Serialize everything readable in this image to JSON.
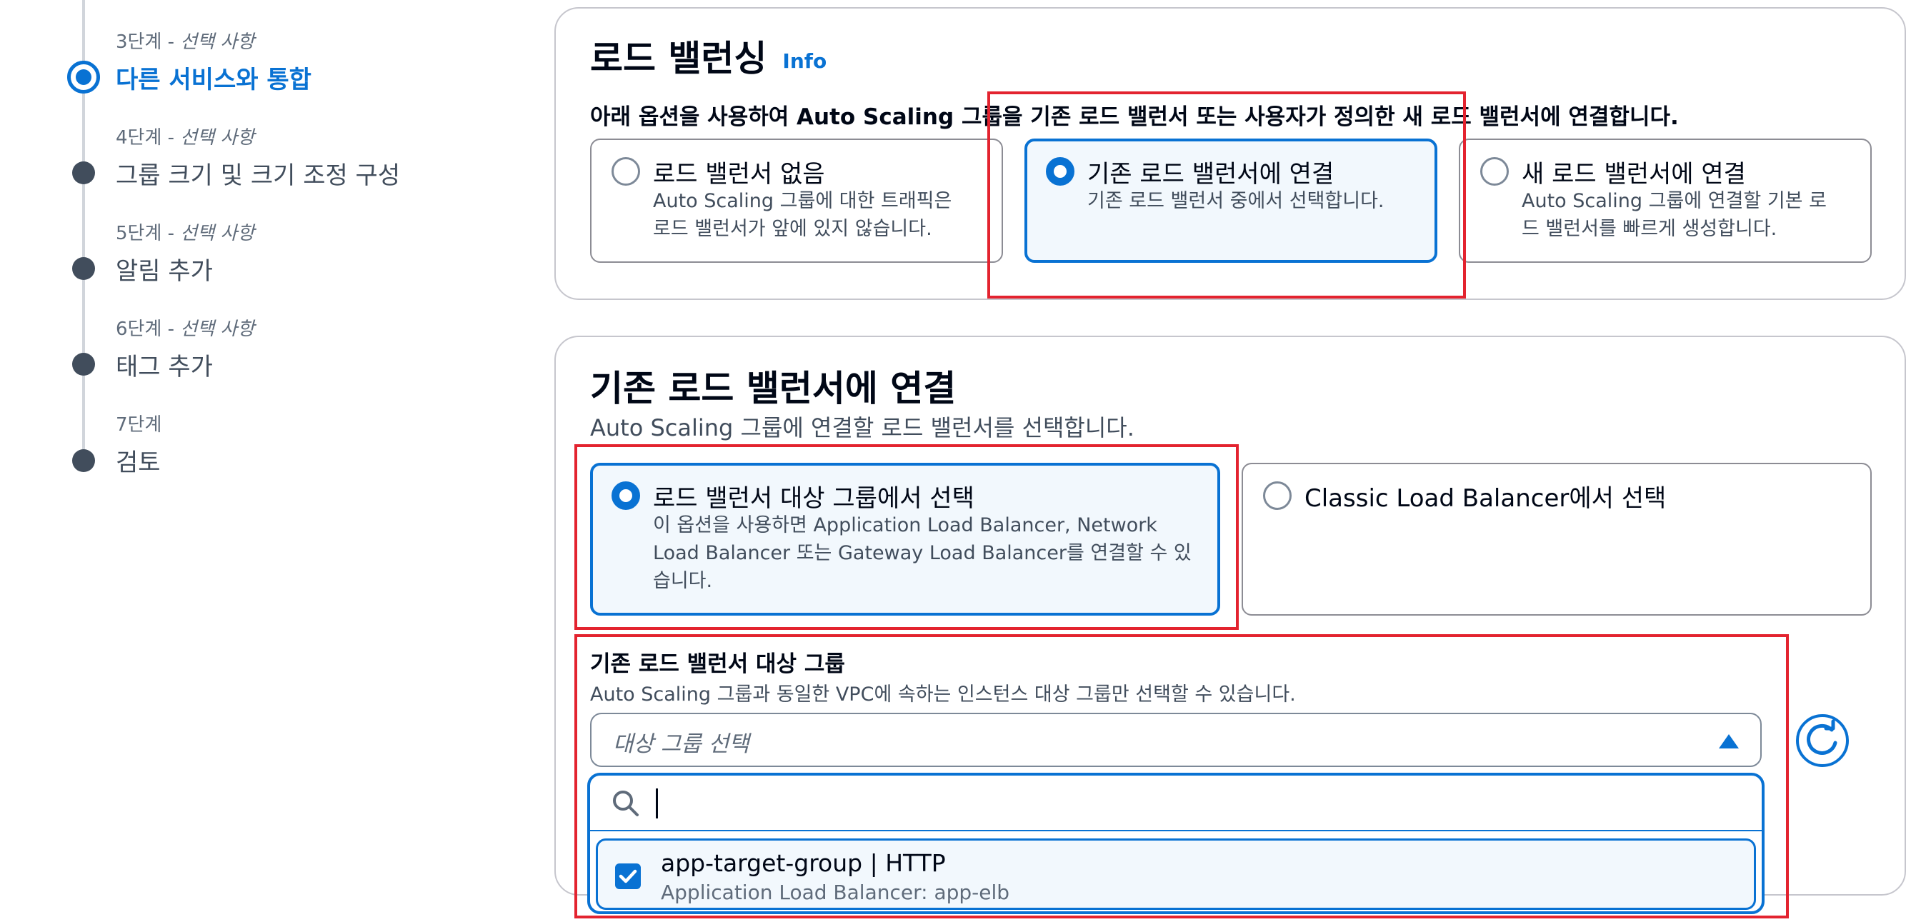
{
  "steps": [
    {
      "label_prefix": "3단계 - ",
      "label_suffix": "선택 사항",
      "title": "다른 서비스와 통합",
      "active": true
    },
    {
      "label_prefix": "4단계 - ",
      "label_suffix": "선택 사항",
      "title": "그룹 크기 및 크기 조정 구성"
    },
    {
      "label_prefix": "5단계 - ",
      "label_suffix": "선택 사항",
      "title": "알림 추가"
    },
    {
      "label_prefix": "6단계 - ",
      "label_suffix": "선택 사항",
      "title": "태그 추가"
    },
    {
      "label_prefix": "7단계",
      "label_suffix": "",
      "title": "검토"
    }
  ],
  "load_balancing": {
    "title": "로드 밸런싱",
    "info": "Info",
    "description": "아래 옵션을 사용하여 Auto Scaling 그룹을 기존 로드 밸런서 또는 사용자가 정의한 새 로드 밸런서에 연결합니다.",
    "options": [
      {
        "title": "로드 밸런서 없음",
        "desc1": "Auto Scaling 그룹에 대한 트래픽은",
        "desc2": "로드 밸런서가 앞에 있지 않습니다."
      },
      {
        "title": "기존 로드 밸런서에 연결",
        "desc1": "기존 로드 밸런서 중에서 선택합니다.",
        "desc2": ""
      },
      {
        "title": "새 로드 밸런서에 연결",
        "desc1": "Auto Scaling 그룹에 연결할 기본 로",
        "desc2": "드 밸런서를 빠르게 생성합니다."
      }
    ],
    "selected_index": 1
  },
  "attach_existing": {
    "title": "기존 로드 밸런서에 연결",
    "description": "Auto Scaling 그룹에 연결할 로드 밸런서를 선택합니다.",
    "options": [
      {
        "title": "로드 밸런서 대상 그룹에서 선택",
        "desc1": "이 옵션을 사용하면 Application Load Balancer, Network",
        "desc2": "Load Balancer 또는 Gateway Load Balancer를 연결할 수 있",
        "desc3": "습니다."
      },
      {
        "title": "Classic Load Balancer에서 선택"
      }
    ],
    "selected_index": 0
  },
  "target_groups": {
    "label": "기존 로드 밸런서 대상 그룹",
    "description": "Auto Scaling 그룹과 동일한 VPC에 속하는 인스턴스 대상 그룹만 선택할 수 있습니다.",
    "placeholder": "대상 그룹 선택",
    "search_value": "",
    "items": [
      {
        "title": "app-target-group | HTTP",
        "subtitle": "Application Load Balancer: app-elb",
        "checked": true
      }
    ]
  },
  "icons": {
    "search": "search-icon",
    "refresh": "refresh-icon",
    "caret": "caret-up-icon",
    "check": "check-icon"
  },
  "colors": {
    "accent": "#0972d3",
    "highlight": "#e3232f",
    "selected_bg": "#f2f8fd"
  }
}
